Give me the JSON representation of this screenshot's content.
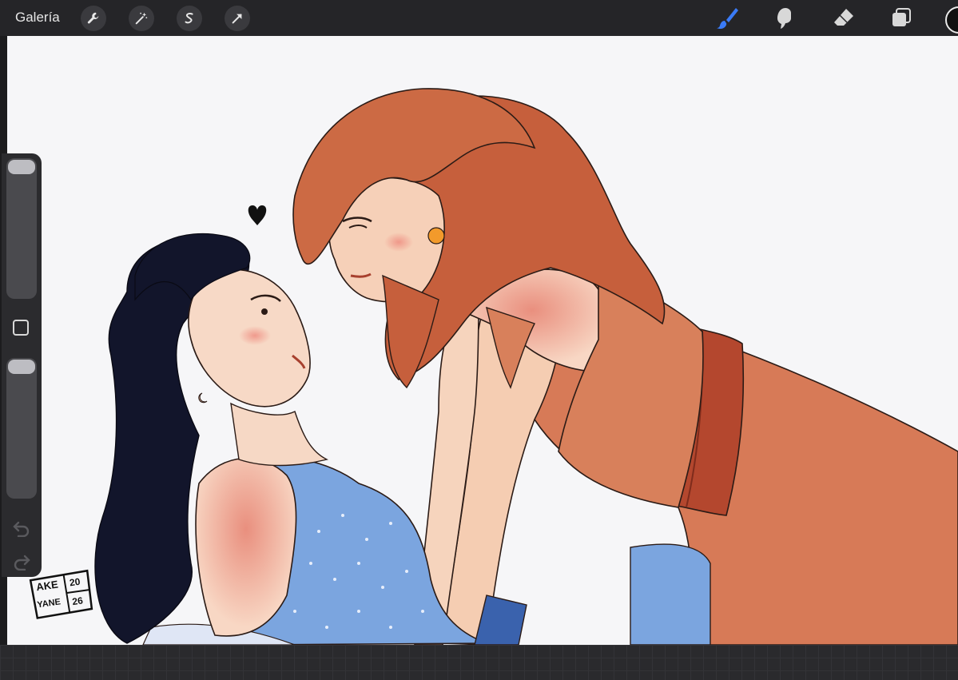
{
  "app": {
    "gallery_label": "Galería"
  },
  "toolbar": {
    "left_icons": [
      "wrench-icon",
      "magic-wand-icon",
      "selection-icon",
      "transform-icon"
    ],
    "right_tools": [
      "brush-icon",
      "smudge-icon",
      "eraser-icon",
      "layers-icon"
    ],
    "active_tool": "brush",
    "active_color": "#111111"
  },
  "sidebar": {
    "brush_size_level": 0,
    "opacity_level": 0
  },
  "signature": {
    "name_top": "AKE",
    "name_bottom": "YANE",
    "year_top": "20",
    "year_bottom": "26"
  },
  "colors": {
    "ui_bar": "#252528",
    "canvas": "#f6f6f8",
    "accent_brush": "#3a7bf7"
  }
}
